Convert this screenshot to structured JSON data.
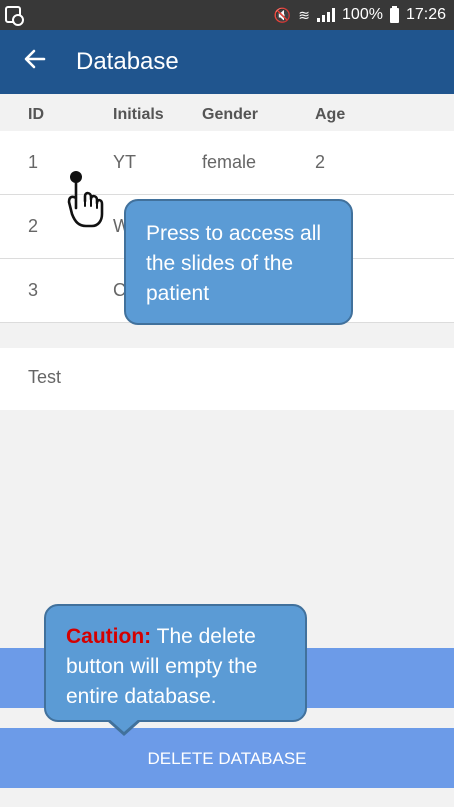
{
  "status_bar": {
    "battery": "100%",
    "time": "17:26"
  },
  "app_bar": {
    "title": "Database"
  },
  "table": {
    "headers": [
      "ID",
      "Initials",
      "Gender",
      "Age"
    ],
    "rows": [
      [
        "1",
        "YT",
        "female",
        "2"
      ],
      [
        "2",
        "W",
        "",
        ""
      ],
      [
        "3",
        "C",
        "",
        ""
      ]
    ]
  },
  "card": {
    "text": "Test"
  },
  "buttons": {
    "delete": "DELETE DATABASE"
  },
  "callouts": {
    "slides": "Press to access all the slides of the patient",
    "caution_label": "Caution:",
    "caution_text": " The delete button will empty the entire database."
  }
}
